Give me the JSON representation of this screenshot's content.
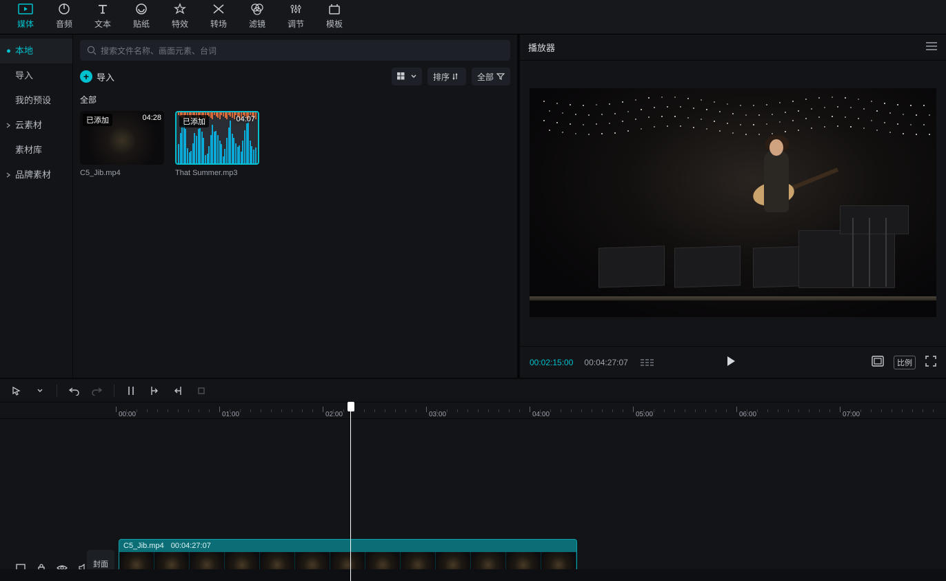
{
  "tabs": [
    {
      "label": "媒体",
      "icon": "media-icon"
    },
    {
      "label": "音频",
      "icon": "audio-icon"
    },
    {
      "label": "文本",
      "icon": "text-icon"
    },
    {
      "label": "贴纸",
      "icon": "sticker-icon"
    },
    {
      "label": "特效",
      "icon": "fx-icon"
    },
    {
      "label": "转场",
      "icon": "transition-icon"
    },
    {
      "label": "滤镜",
      "icon": "filter-icon"
    },
    {
      "label": "调节",
      "icon": "adjust-icon"
    },
    {
      "label": "模板",
      "icon": "template-icon"
    }
  ],
  "sidebar": {
    "items": [
      {
        "label": "本地",
        "active": true,
        "expandable": true
      },
      {
        "label": "导入"
      },
      {
        "label": "我的预设"
      },
      {
        "label": "云素材",
        "expandable": true
      },
      {
        "label": "素材库"
      },
      {
        "label": "品牌素材",
        "expandable": true
      }
    ]
  },
  "search": {
    "placeholder": "搜索文件名称、画面元素、台词"
  },
  "import_label": "导入",
  "view_controls": {
    "sort": "排序",
    "filter": "全部"
  },
  "section_label": "全部",
  "media": [
    {
      "name": "C5_Jib.mp4",
      "duration": "04:28",
      "added_badge": "已添加",
      "kind": "video"
    },
    {
      "name": "That Summer.mp3",
      "duration": "04:07",
      "added_badge": "已添加",
      "kind": "audio"
    }
  ],
  "player": {
    "title": "播放器",
    "current_time": "00:02:15:00",
    "total_time": "00:04:27:07",
    "ratio_label": "比例"
  },
  "timeline": {
    "ruler_labels": [
      "00:00",
      "01:00",
      "02:00",
      "03:00",
      "04:00",
      "05:00",
      "06:00",
      "07:00"
    ],
    "clip": {
      "name": "C5_Jib.mp4",
      "duration": "00:04:27:07"
    },
    "cover_label": "封面"
  }
}
